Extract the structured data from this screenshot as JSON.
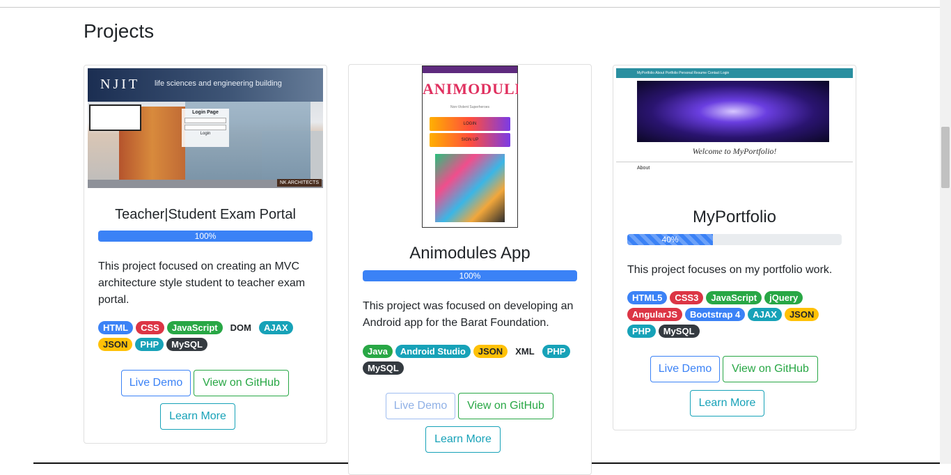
{
  "section_title": "Projects",
  "projects": [
    {
      "title": "Teacher|Student Exam Portal",
      "progress_value": 100,
      "progress_label": "100%",
      "description": "This project focused on creating an MVC architecture style student to teacher exam portal.",
      "thumb": {
        "logo": "NJIT",
        "tagline": "life sciences and engineering building",
        "login_title": "Login Page",
        "login_button": "Login",
        "footer_text": "NK ARCHITECTS"
      },
      "badges": [
        {
          "label": "HTML",
          "color": "#3b82f6"
        },
        {
          "label": "CSS",
          "color": "#dc3545"
        },
        {
          "label": "JavaScript",
          "color": "#28a745"
        },
        {
          "label": "DOM",
          "color": "light"
        },
        {
          "label": "AJAX",
          "color": "#17a2b8"
        },
        {
          "label": "JSON",
          "color": "#ffc107"
        },
        {
          "label": "PHP",
          "color": "#17a2b8"
        },
        {
          "label": "MySQL",
          "color": "#343a40"
        }
      ],
      "buttons": {
        "demo": "Live Demo",
        "github": "View on GitHub",
        "learn": "Learn More"
      }
    },
    {
      "title": "Animodules App",
      "progress_value": 100,
      "progress_label": "100%",
      "description": "This project was focused on developing an Android app for the Barat Foundation.",
      "thumb": {
        "logo": "ANIMODULES",
        "subtitle": "Non-Violent Superheroes",
        "login_button": "LOGIN",
        "signup_button": "SIGN UP"
      },
      "badges": [
        {
          "label": "Java",
          "color": "#28a745"
        },
        {
          "label": "Android Studio",
          "color": "#17a2b8"
        },
        {
          "label": "JSON",
          "color": "#ffc107"
        },
        {
          "label": "XML",
          "color": "light"
        },
        {
          "label": "PHP",
          "color": "#17a2b8"
        },
        {
          "label": "MySQL",
          "color": "#343a40"
        }
      ],
      "buttons": {
        "demo": "Live Demo",
        "github": "View on GitHub",
        "learn": "Learn More"
      }
    },
    {
      "title": "MyPortfolio",
      "progress_value": 40,
      "progress_label": "40%",
      "description": "This project focuses on my portfolio work.",
      "thumb": {
        "nav_text": "MyPortfolio   About   Portfolio   Personal   Resume   Contact   Login",
        "welcome": "Welcome to MyPortfolio!",
        "about_heading": "About"
      },
      "badges": [
        {
          "label": "HTML5",
          "color": "#3b82f6"
        },
        {
          "label": "CSS3",
          "color": "#dc3545"
        },
        {
          "label": "JavaScript",
          "color": "#28a745"
        },
        {
          "label": "jQuery",
          "color": "#28a745"
        },
        {
          "label": "AngularJS",
          "color": "#dc3545"
        },
        {
          "label": "Bootstrap 4",
          "color": "#3b82f6"
        },
        {
          "label": "AJAX",
          "color": "#17a2b8"
        },
        {
          "label": "JSON",
          "color": "#ffc107"
        },
        {
          "label": "PHP",
          "color": "#17a2b8"
        },
        {
          "label": "MySQL",
          "color": "#343a40"
        }
      ],
      "buttons": {
        "demo": "Live Demo",
        "github": "View on GitHub",
        "learn": "Learn More"
      }
    }
  ]
}
